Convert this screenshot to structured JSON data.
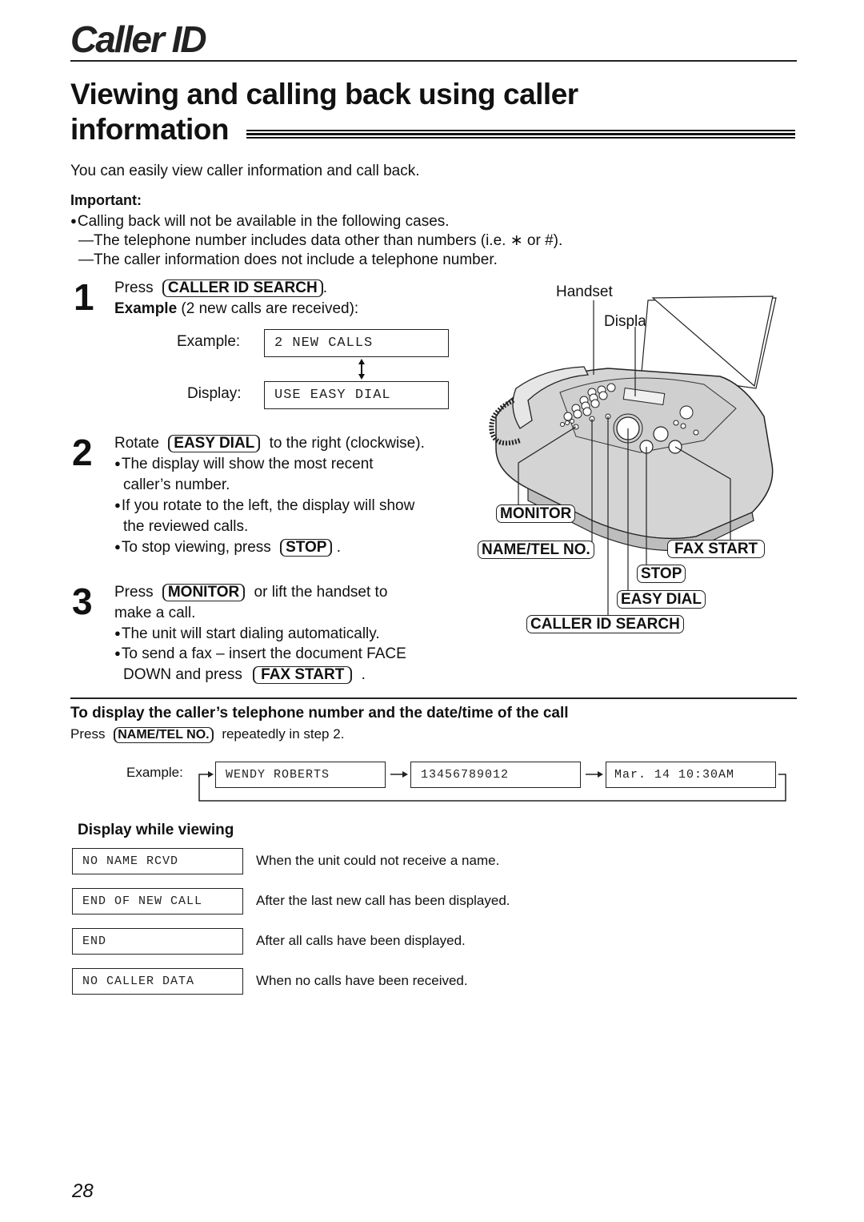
{
  "header": {
    "chapter": "Caller ID",
    "section_title_line1": "Viewing and calling back using caller",
    "section_title_line2": "information"
  },
  "intro": "You can easily view caller information and call back.",
  "important": {
    "label": "Important:",
    "bullet": "Calling back will not be available in the following cases.",
    "cases": [
      "—The telephone number includes data other than numbers (i.e. ∗ or #).",
      "—The caller information does not include a telephone number."
    ]
  },
  "steps": [
    {
      "number": "1",
      "line1_prefix": "Press",
      "key": "CALLER ID SEARCH",
      "line1_suffix": ".",
      "example_bold": "Example",
      "example_rest": " (2 new calls are received):",
      "example_label": "Example:",
      "display_label": "Display:",
      "lcd_example": "2 NEW CALLS",
      "lcd_display": "USE EASY DIAL",
      "toggle_icon": "up-down-arrow"
    },
    {
      "number": "2",
      "line1_prefix": "Rotate",
      "key": "EASY DIAL",
      "line1_suffix": "to the right (clockwise).",
      "bullets": [
        "The display will show the most recent",
        "caller’s number.",
        "If you rotate to the left, the display will show",
        "the reviewed calls."
      ],
      "stop_prefix": "To stop viewing, press",
      "stop_key": "STOP",
      "stop_suffix": "."
    },
    {
      "number": "3",
      "line1_prefix": "Press",
      "key": "MONITOR",
      "line1_suffix": "or lift the handset to",
      "line2": "make a call.",
      "bullet1": "The unit will start dialing automatically.",
      "bullet2": "To send a fax – insert the document FACE",
      "bullet2_cont_prefix": "DOWN and press",
      "fax_key": "FAX START",
      "bullet2_suffix": "."
    }
  ],
  "illustration": {
    "handset_label": "Handset",
    "display_label": "Display",
    "callouts": {
      "monitor": "MONITOR",
      "name_tel": "NAME/TEL NO.",
      "fax_start": "FAX START",
      "stop": "STOP",
      "easy_dial": "EASY DIAL",
      "caller_id_search": "CALLER ID SEARCH"
    }
  },
  "subsection": {
    "title": "To display the caller’s telephone number and the date/time of the call",
    "press": "Press",
    "key": "NAME/TEL NO.",
    "suffix": "repeatedly in step 2.",
    "example_label": "Example:",
    "cycle": [
      "WENDY ROBERTS",
      "13456789012",
      "Mar. 14 10:30AM"
    ]
  },
  "display_while_viewing": {
    "title": "Display while viewing",
    "rows": [
      {
        "lcd": "NO NAME RCVD",
        "desc": "When the unit could not receive a name."
      },
      {
        "lcd": "END OF NEW CALL",
        "desc": "After the last new call has been displayed."
      },
      {
        "lcd": "END",
        "desc": "After all calls have been displayed."
      },
      {
        "lcd": "NO CALLER DATA",
        "desc": "When no calls have been received."
      }
    ]
  },
  "page_number": "28"
}
